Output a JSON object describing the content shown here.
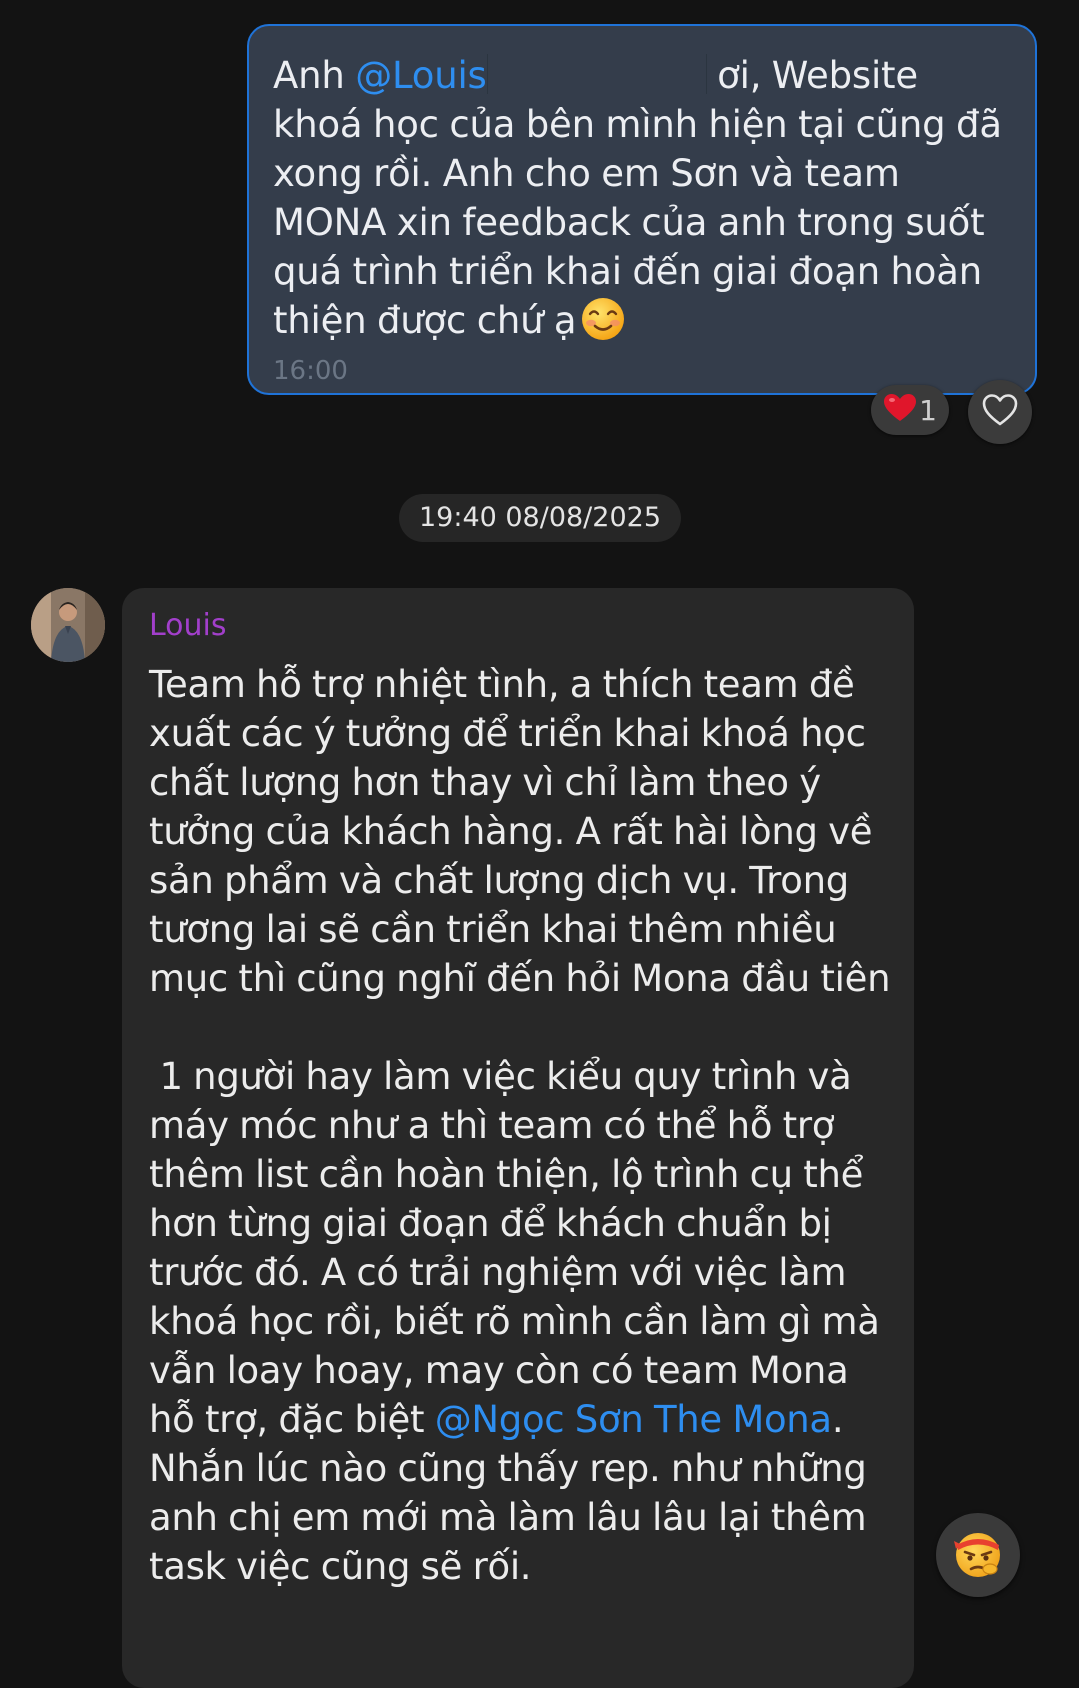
{
  "outgoing_message": {
    "line1_prefix": "Anh ",
    "mention": "@Louis",
    "line1_suffix": " ơi, Website",
    "body": "khoá học của bên mình hiện tại cũng đã xong rồi. Anh cho em Sơn và team MONA xin feedback của anh trong suốt quá trình triển khai đến giai đoạn hoàn thiện được chứ ạ",
    "emoji": "smiling-face-with-smiling-eyes",
    "time": "16:00",
    "reaction": {
      "emoji": "red-heart",
      "count": "1"
    }
  },
  "date_divider": "19:40 08/08/2025",
  "incoming_message": {
    "sender": "Louis",
    "paragraph1": "Team hỗ trợ nhiệt tình, a thích team đề xuất các ý tưởng để triển khai khoá học chất lượng hơn thay vì chỉ làm theo ý tưởng của khách hàng. A rất hài lòng về sản phẩm và chất lượng dịch vụ. Trong tương lai sẽ cần triển khai thêm nhiều mục thì cũng nghĩ đến hỏi Mona đầu tiên",
    "paragraph2_before_mention": " 1 người hay làm việc kiểu quy trình và máy móc như a thì team có thể hỗ trợ thêm list cần hoàn thiện, lộ trình cụ thể hơn từng giai đoạn để khách chuẩn bị trước đó. A có trải nghiệm với việc làm khoá học rồi, biết rõ mình cần làm gì mà vẫn loay hoay, may còn có team Mona hỗ trợ, đặc biệt ",
    "mention": "@Ngọc Sơn The Mona",
    "paragraph2_after_mention": ". Nhắn lúc nào cũng thấy rep. như những anh chị em mới mà làm lâu lâu lại thêm task việc cũng sẽ rối."
  },
  "floating_reaction_button": {
    "emoji": "angry-face-with-headband"
  },
  "colors": {
    "background": "#131313",
    "outgoing_bubble": "#343d4b",
    "outgoing_border": "#1f73d8",
    "incoming_bubble": "#282828",
    "mention": "#2e8ef0",
    "sender_name": "#a23fcb"
  }
}
